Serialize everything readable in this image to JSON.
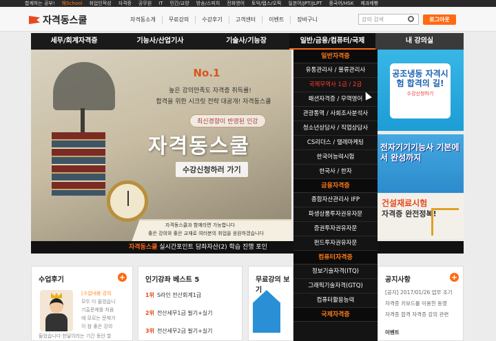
{
  "topbar": {
    "items": [
      "합께하는 공부!",
      "해School",
      "취업인적성",
      "자격증",
      "공무원",
      "IT",
      "민간/교양",
      "방송/스피치",
      "전화영어",
      "토익/텝스/오픽",
      "일본어/JPT/JLPT",
      "중국어/HSK",
      "제과제빵"
    ]
  },
  "header": {
    "logo": "자격동스쿨",
    "nav": [
      "자격동소개",
      "무료강의",
      "수강후기",
      "고객센터",
      "이벤트",
      "장바구니"
    ],
    "search_placeholder": "강의 검색",
    "login": "로그아웃"
  },
  "mainnav": {
    "items": [
      {
        "label": "세무/회계자격증",
        "active": false
      },
      {
        "label": "기능사/산업기사",
        "active": false
      },
      {
        "label": "기술사/기능장",
        "active": false
      },
      {
        "label": "일반/금융/컴퓨터/국제",
        "active": true
      },
      {
        "label": "내 강의실",
        "active": false
      }
    ]
  },
  "hero": {
    "badge": "No.1",
    "line1": "높은 강의만족도 자격증 취득률!",
    "line2": "합격을 위한 시크릿 전략 대공개! 자격동스쿨",
    "pill": "최신경향이 반영된 인강",
    "title": "자격동스쿨",
    "cta": "수강신청하러 가기",
    "foot1": "자격동스쿨과 함께라면 가능합니다",
    "foot2": "좋은 강의와 좋은 교재로 여러분의 취업을 응원하겠습니다"
  },
  "dropdown": {
    "sections": [
      {
        "head": "일반자격증",
        "items": [
          "유통관리사 / 물류관리사",
          "국제무역사 1급 / 2급",
          "패션자격증 / 무역영어",
          "관광통역 / 사회조사분석사",
          "청소년상담사 / 직업상담사",
          "CS리더스 / 텔레마케팅",
          "한국어능력시험",
          "한국사 / 한자"
        ]
      },
      {
        "head": "금융자격증",
        "items": [
          "종합자산관리사 IFP",
          "파생상품투자권유자문",
          "증권투자권유자문",
          "펀드투자권유자문"
        ]
      },
      {
        "head": "컴퓨터자격증",
        "items": [
          "정보기술자격(ITQ)",
          "그래픽기술자격(GTQ)",
          "컴퓨터활용능력"
        ]
      },
      {
        "head": "국제자격증",
        "items": []
      }
    ],
    "selected": "국제무역사 1급 / 2급"
  },
  "banners": {
    "b1": {
      "title": "공조냉동 자격시험 합격의 길!",
      "sub": "수강신청하기"
    },
    "b2": {
      "title": "전자기기기능사 기본에서 완성까지"
    },
    "b3": {
      "title": "건설재료시험",
      "sub": "자격증 완전정복!"
    }
  },
  "ticker": {
    "tag": "자격동스쿨",
    "text": "실시간포인트 담좌자산(2) 학습 진행 포인"
  },
  "reviews": {
    "title": "수업후기",
    "lines": [
      "[수업내용 강의",
      "모두 다 들었습니",
      "기출문제를 처음",
      "에 모르는 문제가",
      "이 참 좋은 강의",
      "들었습니다 한달이라는 기간 동안 할"
    ]
  },
  "popular": {
    "title": "인기강좌 베스트 5",
    "items": [
      {
        "rank": "1위",
        "name": "S라인 전산회계1급"
      },
      {
        "rank": "2위",
        "name": "전산세무1급 필기+실기"
      },
      {
        "rank": "3위",
        "name": "전산세무2급 필기+실기"
      }
    ]
  },
  "free": {
    "title": "무료강의 보기"
  },
  "notice": {
    "title": "공지사항",
    "items": [
      "[공지] 2017/01/26 업무 조기",
      "자격증 키보드를 이용한 동영",
      "자격증 합격 자격증 강의 관련",
      "이벤트"
    ]
  }
}
